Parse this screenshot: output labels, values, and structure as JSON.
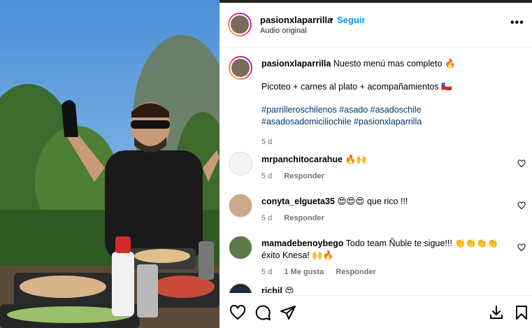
{
  "post": {
    "username": "pasionxlaparrilla",
    "separator": "•",
    "follow_label": "Seguir",
    "audio_label": "Audio original",
    "more_label": "•••"
  },
  "caption": {
    "username": "pasionxlaparrilla",
    "text": "Nuesto menú mas completo 🔥",
    "line2": "Picoteo + carnes al plato + acompañamientos 🇨🇱",
    "hashtags": "#parrilleroschilenos #asado #asadoschile #asadosadomiciliochile #pasionxlaparrilla",
    "time": "5 d"
  },
  "comments": [
    {
      "username": "mrpanchitocarahue",
      "text": "🔥🙌",
      "time": "5 d",
      "likes": "",
      "reply_label": "Responder"
    },
    {
      "username": "conyta_elgueta35",
      "text": "😍😍😍 que rico !!!",
      "time": "5 d",
      "likes": "",
      "reply_label": "Responder"
    },
    {
      "username": "mamadebenoybego",
      "text": "Todo team Ñuble te sigue!!! 👏👏👏👏 éxito Knesa! 🙌🔥",
      "time": "5 d",
      "likes": "1 Me gusta",
      "reply_label": "Responder"
    },
    {
      "username": "richil",
      "text": "😍",
      "time": "",
      "likes": "",
      "reply_label": ""
    }
  ],
  "icons": {
    "more": "more-options-icon",
    "heart": "heart-icon",
    "comment": "comment-icon",
    "share": "share-icon",
    "save": "bookmark-icon",
    "download": "download-icon"
  },
  "colors": {
    "link": "#0095f6",
    "hashtag": "#00376b",
    "meta": "#737373"
  }
}
